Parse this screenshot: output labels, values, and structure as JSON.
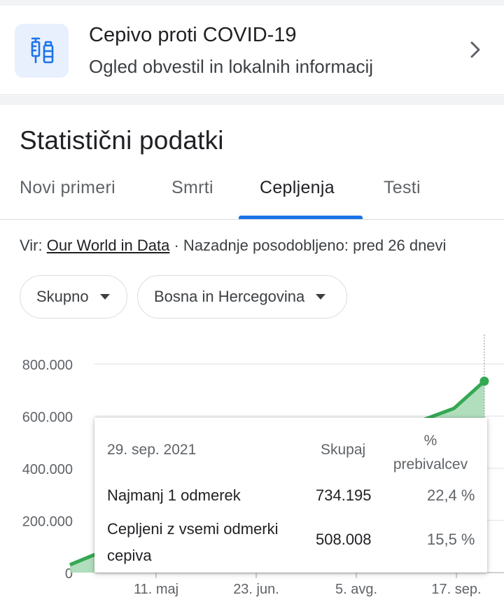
{
  "vaccine_card": {
    "title": "Cepivo proti COVID-19",
    "subtitle": "Ogled obvestil in lokalnih informacij",
    "icon": "vaccine-icon",
    "chevron_icon": "chevron-right-icon"
  },
  "stats": {
    "title": "Statistični podatki"
  },
  "tabs": [
    {
      "label": "Novi primeri",
      "active": false
    },
    {
      "label": "Smrti",
      "active": false
    },
    {
      "label": "Cepljenja",
      "active": true
    },
    {
      "label": "Testi",
      "active": false
    }
  ],
  "source": {
    "prefix": "Vir: ",
    "link": "Our World in Data",
    "suffix": " · Nazadnje posodobljeno: pred 26 dnevi"
  },
  "filters": {
    "measure": "Skupno",
    "region": "Bosna in Hercegovina"
  },
  "colors": {
    "accent": "#1a73e8",
    "series_line": "#34a853",
    "series_fill": "#a8dab5",
    "icon_bg": "#e8f0fe"
  },
  "chart_data": {
    "type": "area",
    "y_ticks": [
      "800.000",
      "600.000",
      "400.000",
      "200.000",
      "0"
    ],
    "y_tick_values": [
      800000,
      600000,
      400000,
      200000,
      0
    ],
    "x_ticks": [
      "11. maj",
      "23. jun.",
      "5. avg.",
      "17. sep."
    ],
    "x_tick_dates": [
      "2021-05-11",
      "2021-06-23",
      "2021-08-05",
      "2021-09-17"
    ],
    "ylim": [
      0,
      800000
    ],
    "grid": true,
    "series": [
      {
        "points": [
          {
            "date": "2021-04-04",
            "value": 30000
          },
          {
            "date": "2021-08-15",
            "value": 520000
          },
          {
            "date": "2021-09-04",
            "value": 590000
          },
          {
            "date": "2021-09-16",
            "value": 630000
          },
          {
            "date": "2021-09-29",
            "value": 734195
          }
        ]
      }
    ],
    "tooltip": {
      "date": "29. sep. 2021",
      "col_total": "Skupaj",
      "col_percent": "% prebivalcev",
      "rows": [
        {
          "label": "Najmanj 1 odmerek",
          "value": "734.195",
          "percent": "22,4 %"
        },
        {
          "label": "Cepljeni z vsemi odmerki cepiva",
          "value": "508.008",
          "percent": "15,5 %"
        }
      ]
    }
  }
}
